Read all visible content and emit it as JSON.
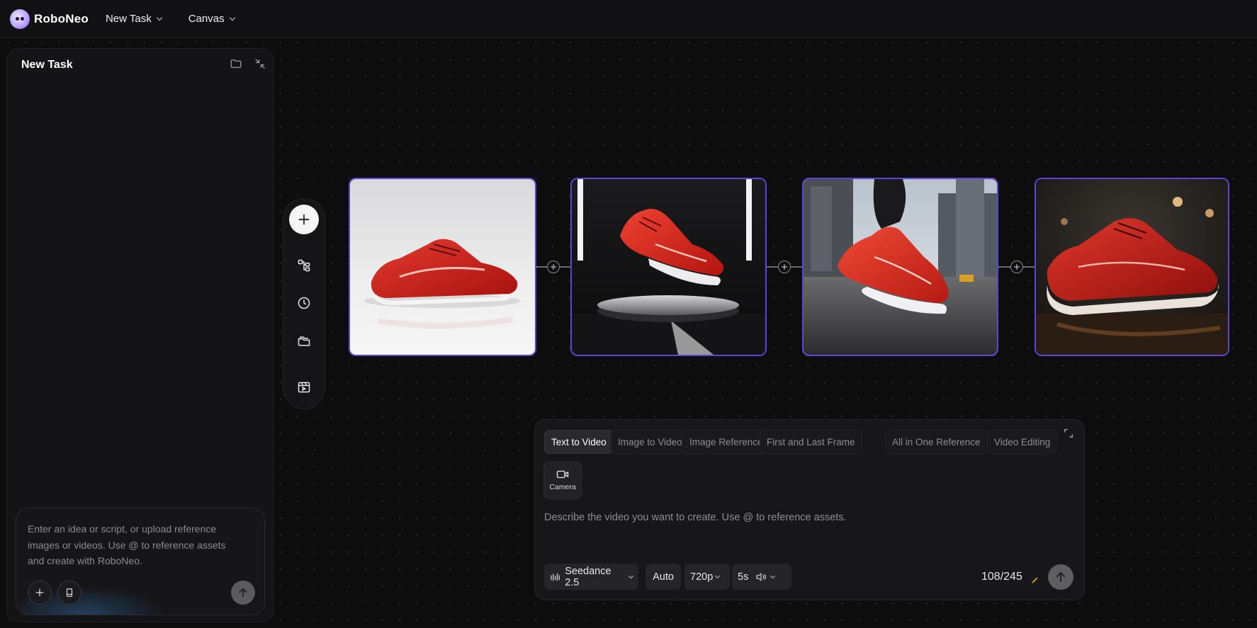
{
  "app": {
    "name": "RoboNeo",
    "menus": [
      {
        "label": "New Task",
        "icon": "chevron-down-icon"
      },
      {
        "label": "Canvas",
        "icon": "chevron-down-icon"
      }
    ]
  },
  "left_panel": {
    "title": "New Task",
    "icons": [
      "folder-icon",
      "collapse-icon"
    ],
    "chat_input": {
      "placeholder": "Enter an idea or script, or upload reference images or videos.  Use @ to reference assets and create with RoboNeo.",
      "buttons": [
        "add-icon",
        "device-icon",
        "send-arrow-icon"
      ]
    }
  },
  "toolbar": {
    "items": [
      "add-icon",
      "workflow-icon",
      "history-icon",
      "folder-icon",
      "video-template-icon"
    ]
  },
  "canvas": {
    "accent_color": "#5b46d6",
    "images": [
      {
        "subject": "red running shoe on white studio background"
      },
      {
        "subject": "red running shoe floating above metal pedestal"
      },
      {
        "subject": "red running shoe stepping on city street"
      },
      {
        "subject": "red running shoe on wet street at night"
      }
    ],
    "connector_icon": "plus-circle-icon"
  },
  "generator": {
    "tabs": [
      {
        "label": "Text to Video",
        "active": true
      },
      {
        "label": "Image to Video",
        "active": false
      },
      {
        "label": "Image Reference",
        "active": false
      },
      {
        "label": "First and Last Frame",
        "active": false
      },
      {
        "label": "All in One Reference",
        "active": false
      },
      {
        "label": "Video Editing",
        "active": false
      }
    ],
    "camera_label": "Camera",
    "placeholder": "Describe the video you want to create. Use @ to reference assets.",
    "model": "Seedance 2.5",
    "ratio": "Auto",
    "resolution": "720p",
    "duration": "5s",
    "counter": "108/245"
  }
}
